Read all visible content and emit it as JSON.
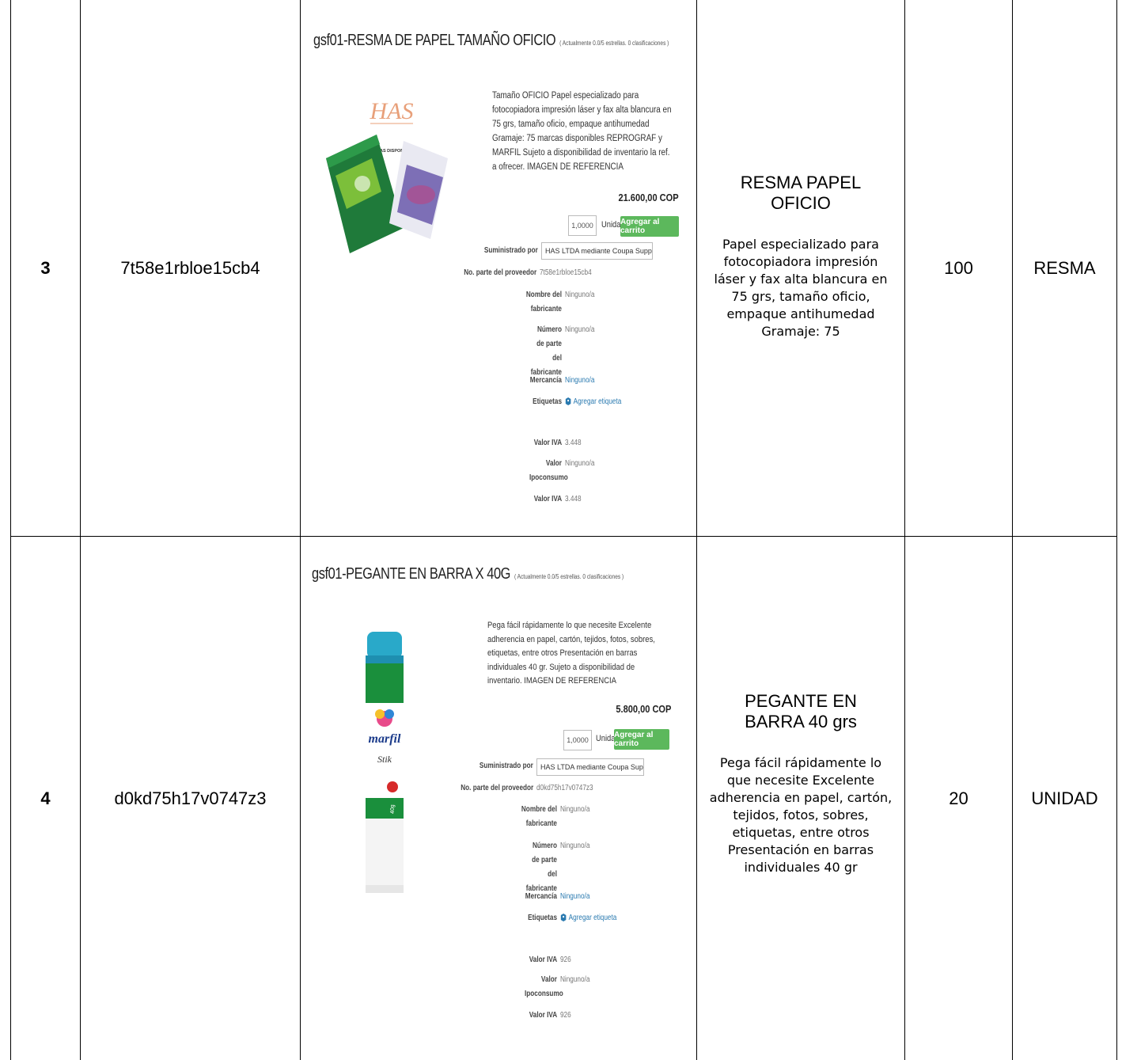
{
  "rows": [
    {
      "number": "3",
      "code": "7t58e1rbloe15cb4",
      "screenshot": {
        "title": "gsf01-RESMA DE PAPEL TAMAÑO OFICIO",
        "rating": "( Actualmente 0.0/5 estrellas. 0 clasificaciones )",
        "description": "Tamaño OFICIO Papel especializado para fotocopiadora impresión láser y fax alta blancura en 75 grs, tamaño oficio, empaque antihumedad Gramaje: 75 marcas disponibles REPROGRAF y MARFIL Sujeto a disponibilidad de inventario la ref. a ofrecer. IMAGEN DE REFERENCIA",
        "price": "21.600,00 COP",
        "quantity": "1,0000",
        "unit_label": "Unidad",
        "cart_button": "Agregar al carrito",
        "supplied_by_label": "Suministrado por",
        "supplied_by_value": "HAS LTDA mediante Coupa Supplier Portal",
        "fields": [
          {
            "label": "No. parte del proveedor",
            "value": "7t58e1rbloe15cb4"
          },
          {
            "label": "Nombre del fabricante",
            "value": "Ninguno/a"
          },
          {
            "label": "Número de parte del fabricante",
            "value": "Ninguno/a"
          },
          {
            "label": "Mercancía",
            "value": "Ninguno/a"
          },
          {
            "label": "Etiquetas",
            "value": "Agregar etiqueta"
          },
          {
            "label": "Valor IVA",
            "value": "3.448"
          },
          {
            "label": "Valor Ipoconsumo",
            "value": "Ninguno/a"
          },
          {
            "label": "Valor IVA",
            "value": "3.448"
          }
        ],
        "image_text": {
          "logo": "HAS",
          "brands": "MARCAS DISPONIBLES"
        }
      },
      "desc_title": "RESMA PAPEL OFICIO",
      "desc_body": "Papel especializado para fotocopiadora impresión láser y fax alta blancura en 75 grs, tamaño oficio, empaque antihumedad Gramaje: 75",
      "quantity": "100",
      "unit": "RESMA"
    },
    {
      "number": "4",
      "code": "d0kd75h17v0747z3",
      "screenshot": {
        "title": "gsf01-PEGANTE EN BARRA X 40G",
        "rating": "( Actualmente 0.0/5 estrellas. 0 clasificaciones )",
        "description": "Pega fácil rápidamente lo que necesite Excelente adherencia en papel, cartón, tejidos, fotos, sobres, etiquetas, entre otros Presentación en barras individuales 40 gr. Sujeto a disponibilidad de inventario. IMAGEN DE REFERENCIA",
        "price": "5.800,00 COP",
        "quantity": "1,0000",
        "unit_label": "Unidad",
        "cart_button": "Agregar al carrito",
        "supplied_by_label": "Suministrado por",
        "supplied_by_value": "HAS LTDA mediante Coupa Supplier Portal",
        "fields": [
          {
            "label": "No. parte del proveedor",
            "value": "d0kd75h17v0747z3"
          },
          {
            "label": "Nombre del fabricante",
            "value": "Ninguno/a"
          },
          {
            "label": "Número de parte del fabricante",
            "value": "Ninguno/a"
          },
          {
            "label": "Mercancía",
            "value": "Ninguno/a"
          },
          {
            "label": "Etiquetas",
            "value": "Agregar etiqueta"
          },
          {
            "label": "Valor IVA",
            "value": "926"
          },
          {
            "label": "Valor Ipoconsumo",
            "value": "Ninguno/a"
          },
          {
            "label": "Valor IVA",
            "value": "926"
          }
        ],
        "image_text": {
          "brand": "marfil",
          "size": "40g"
        }
      },
      "desc_title": "PEGANTE EN BARRA 40 grs",
      "desc_body": "Pega fácil rápidamente lo que necesite Excelente adherencia en papel, cartón, tejidos, fotos, sobres, etiquetas, entre otros Presentación en barras individuales 40 gr",
      "quantity": "20",
      "unit": "UNIDAD"
    }
  ],
  "colors": {
    "cart_button": "#5cb85c",
    "link": "#2a7ab0",
    "glue_cap": "#29a9c9"
  }
}
